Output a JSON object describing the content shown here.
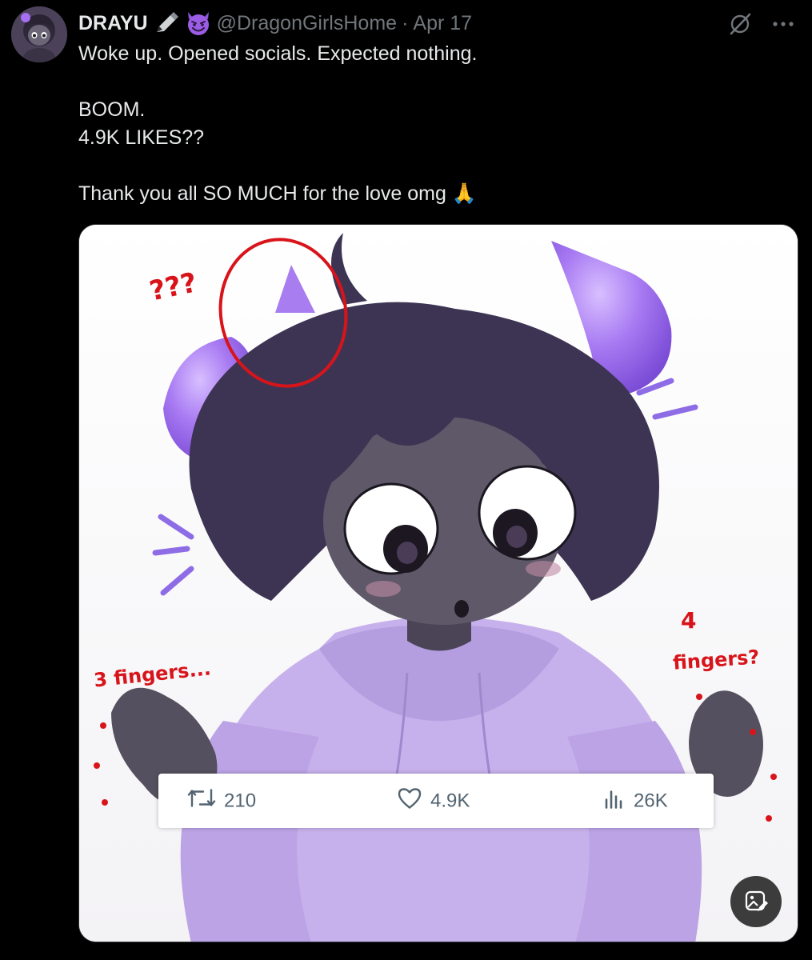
{
  "post": {
    "author": {
      "display_name": "DRAYU",
      "handle": "@DragonGirlsHome",
      "separator": "·",
      "date": "Apr 17",
      "name_icons": [
        "pen-icon",
        "smiling-devil-icon"
      ]
    },
    "text_lines": [
      "Woke up. Opened socials. Expected nothing.",
      "",
      "BOOM.",
      "4.9K LIKES??",
      "",
      "Thank you all SO MUCH for the love omg"
    ],
    "text_trailing_emoji": "🙏",
    "actions": {
      "grok_icon": "grok-icon",
      "more_icon": "more-icon"
    }
  },
  "media": {
    "annotations": {
      "question": "???",
      "three_fingers": "3 fingers...",
      "four_num": "4",
      "four_word": "fingers?"
    },
    "stats_card": {
      "retweets": "210",
      "likes": "4.9K",
      "views": "26K"
    },
    "alt_button_icon": "image-edit-icon"
  },
  "colors": {
    "background": "#000000",
    "text": "#e7e9ea",
    "muted": "#71767b",
    "annotation_red": "#d8141a",
    "horn_purple": "#9b6df0",
    "hoodie_lavender": "#c7b1ec",
    "hair": "#3d3453"
  }
}
